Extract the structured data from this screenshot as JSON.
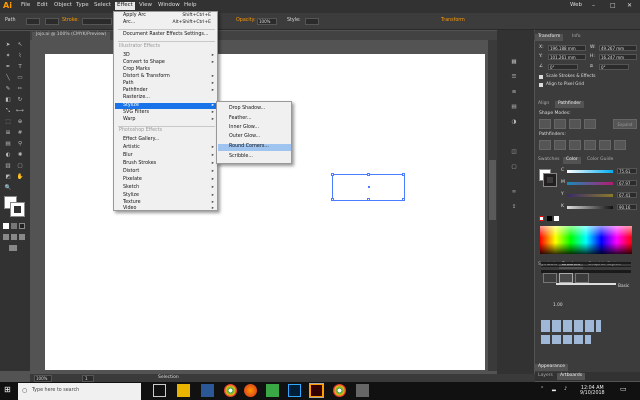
{
  "app": {
    "logo": "Ai"
  },
  "menubar": {
    "items": [
      "File",
      "Edit",
      "Object",
      "Type",
      "Select",
      "Effect",
      "View",
      "Window",
      "Help"
    ],
    "active": "Effect",
    "workspace": "Web"
  },
  "controlbar": {
    "selection_label": "Path",
    "stroke_label": "Stroke:",
    "opacity_label": "Opacity:",
    "opacity_value": "100%",
    "style_label": "Style:",
    "transform_label": "Transform"
  },
  "document": {
    "tab": "Jojo.ai @ 100% (CMYK/Preview)",
    "zoom": "100%",
    "status": "Selection",
    "page": "1"
  },
  "effect_menu": {
    "items": [
      {
        "label": "Apply Arc",
        "shortcut": "Shift+Ctrl+E"
      },
      {
        "label": "Arc...",
        "shortcut": "Alt+Shift+Ctrl+E"
      },
      {
        "label": "Document Raster Effects Settings..."
      },
      {
        "label": "Illustrator Effects",
        "header": true
      },
      {
        "label": "3D",
        "sub": true
      },
      {
        "label": "Convert to Shape",
        "sub": true
      },
      {
        "label": "Crop Marks"
      },
      {
        "label": "Distort & Transform",
        "sub": true
      },
      {
        "label": "Path",
        "sub": true
      },
      {
        "label": "Pathfinder",
        "sub": true
      },
      {
        "label": "Rasterize..."
      },
      {
        "label": "Stylize",
        "sub": true,
        "highlight": true
      },
      {
        "label": "SVG Filters",
        "sub": true
      },
      {
        "label": "Warp",
        "sub": true
      },
      {
        "label": "Photoshop Effects",
        "header": true
      },
      {
        "label": "Effect Gallery..."
      },
      {
        "label": "Artistic",
        "sub": true
      },
      {
        "label": "Blur",
        "sub": true
      },
      {
        "label": "Brush Strokes",
        "sub": true
      },
      {
        "label": "Distort",
        "sub": true
      },
      {
        "label": "Pixelate",
        "sub": true
      },
      {
        "label": "Sketch",
        "sub": true
      },
      {
        "label": "Stylize",
        "sub": true
      },
      {
        "label": "Texture",
        "sub": true
      },
      {
        "label": "Video",
        "sub": true
      }
    ]
  },
  "stylize_menu": {
    "items": [
      "Drop Shadow...",
      "Feather...",
      "Inner Glow...",
      "Outer Glow...",
      "Round Corners...",
      "Scribble..."
    ],
    "highlighted": "Round Corners..."
  },
  "transform_panel": {
    "tabs": [
      "Transform",
      "Info"
    ],
    "x_label": "X:",
    "x": "196.188 mm",
    "y_label": "Y:",
    "y": "101.261 mm",
    "w_label": "W:",
    "w": "49.267 mm",
    "h_label": "H:",
    "h": "16.247 mm",
    "angle": "0°",
    "shear": "0°",
    "scale_strokes": "Scale Strokes & Effects",
    "align_pixel": "Align to Pixel Grid"
  },
  "pathfinder_panel": {
    "tabs": [
      "Align",
      "Pathfinder"
    ],
    "shape_modes": "Shape Modes:",
    "pathfinders": "Pathfinders:",
    "expand": "Expand"
  },
  "color_panel": {
    "tabs": [
      "Swatches",
      "Color",
      "Color Guide"
    ],
    "channels": [
      {
        "label": "C",
        "value": "75.61",
        "color": "#00aeef"
      },
      {
        "label": "M",
        "value": "67.97",
        "color": "#ec008c"
      },
      {
        "label": "Y",
        "value": "67.41",
        "color": "#fff200"
      },
      {
        "label": "K",
        "value": "90.16",
        "color": "#231f20"
      }
    ]
  },
  "brushes_panel": {
    "tabs": [
      "Symbols",
      "Brushes",
      "Graphic Styles"
    ],
    "basic": "Basic",
    "size": "1.00"
  },
  "bottom_tabs": {
    "appearance": "Appearance",
    "layers": "Layers",
    "artboards": "Artboards"
  },
  "taskbar": {
    "search_placeholder": "Type here to search",
    "time": "12:04 AM",
    "date": "9/10/2018",
    "apps": [
      "Task View",
      "File Explorer",
      "Word",
      "Chrome",
      "Firefox",
      "Camtasia",
      "Photoshop",
      "Illustrator",
      "Chrome2",
      "Media"
    ]
  }
}
